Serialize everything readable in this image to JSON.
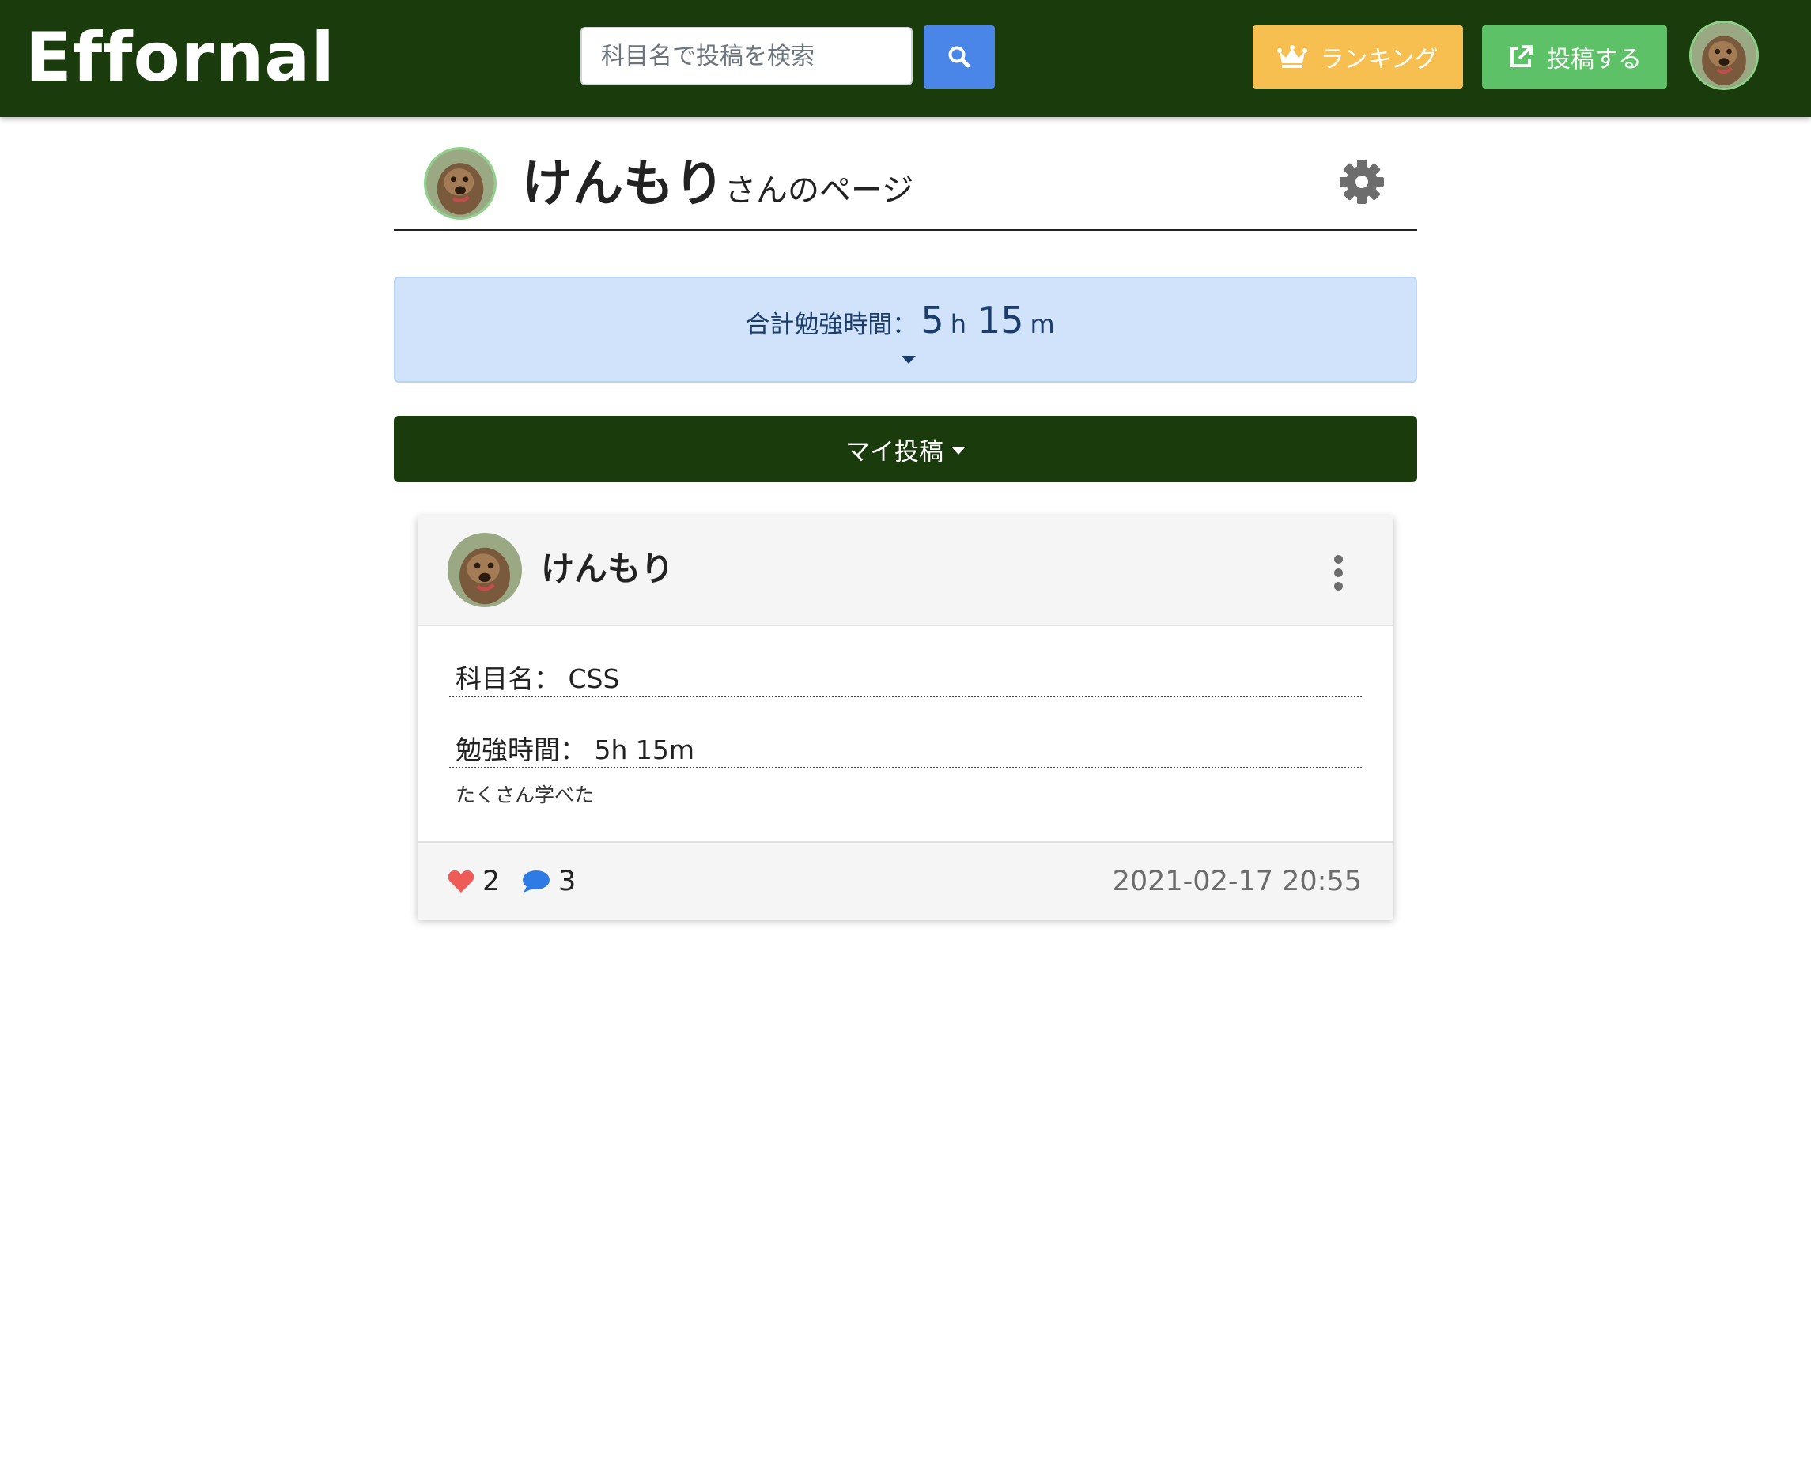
{
  "navbar": {
    "brand": "Effornal",
    "search_placeholder": "科目名で投稿を検索",
    "ranking_label": "ランキング",
    "post_label": "投稿する",
    "colors": {
      "background": "#1a3b0c",
      "search_button": "#4a86e8",
      "ranking_button": "#f6bf4f",
      "post_button": "#5cc167"
    }
  },
  "profile": {
    "username": "けんもり",
    "suffix": "さんのページ"
  },
  "total": {
    "label": "合計勉強時間：",
    "hours": "5",
    "hours_unit": "h",
    "minutes": "15",
    "minutes_unit": "m"
  },
  "myposts": {
    "label": "マイ投稿"
  },
  "post": {
    "username": "けんもり",
    "subject_label": "科目名：",
    "subject_value": "CSS",
    "time_label": "勉強時間：",
    "time_value": "5h 15m",
    "comment": "たくさん学べた",
    "likes": "2",
    "comments": "3",
    "timestamp": "2021-02-17 20:55"
  },
  "icons": {
    "search": "search-icon",
    "ranking": "crown-icon",
    "post": "external-link-icon",
    "settings": "gear-icon",
    "menu": "kebab-menu-icon",
    "like": "heart-icon",
    "comment": "comment-bubble-icon"
  }
}
